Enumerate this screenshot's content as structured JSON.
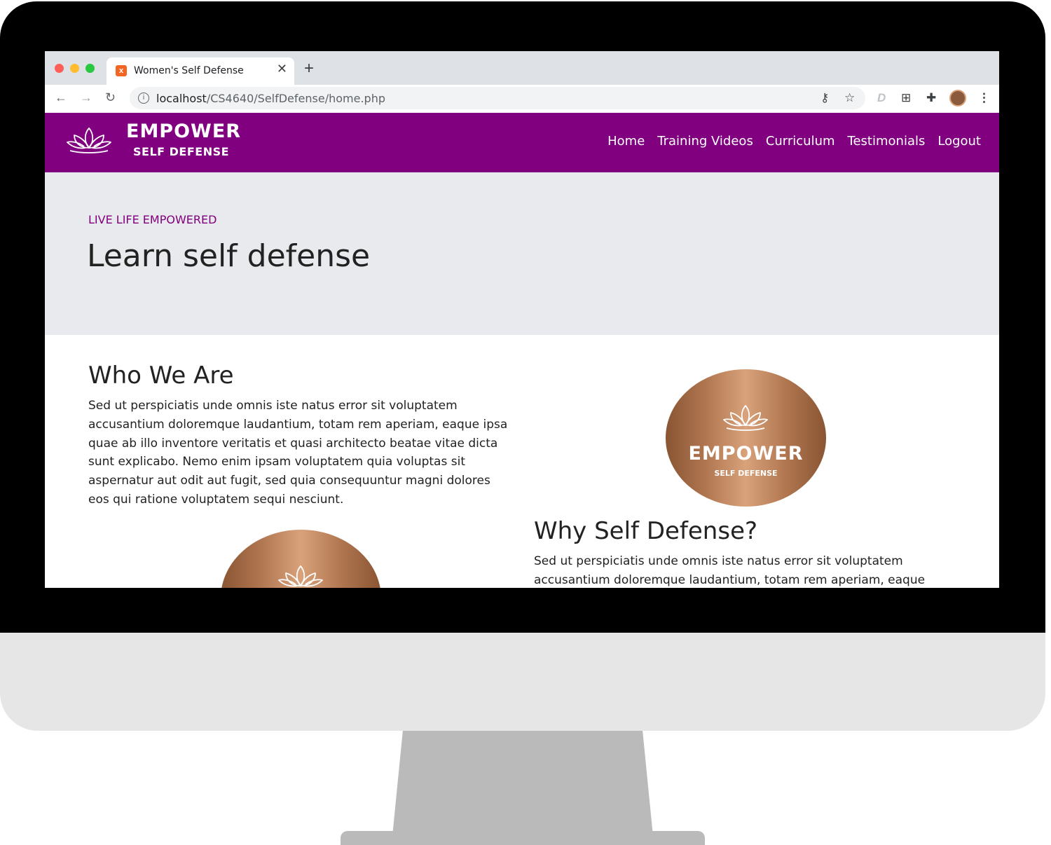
{
  "browser": {
    "tab_title": "Women's Self Defense",
    "url_host": "localhost",
    "url_path": "/CS4640/SelfDefense/home.php"
  },
  "site": {
    "brand_name": "EMPOWER",
    "brand_sub": "SELF DEFENSE",
    "brand_color": "#800080",
    "nav": [
      "Home",
      "Training Videos",
      "Curriculum",
      "Testimonials",
      "Logout"
    ]
  },
  "hero": {
    "eyebrow": "LIVE LIFE EMPOWERED",
    "title": "Learn self defense"
  },
  "sections": {
    "who": {
      "title": "Who We Are",
      "body": "Sed ut perspiciatis unde omnis iste natus error sit voluptatem accusantium doloremque laudantium, totam rem aperiam, eaque ipsa quae ab illo inventore veritatis et quasi architecto beatae vitae dicta sunt explicabo. Nemo enim ipsam voluptatem quia voluptas sit aspernatur aut odit aut fugit, sed quia consequuntur magni dolores eos qui ratione voluptatem sequi nesciunt."
    },
    "why": {
      "title": "Why Self Defense?",
      "body": "Sed ut perspiciatis unde omnis iste natus error sit voluptatem accusantium doloremque laudantium, totam rem aperiam, eaque"
    }
  },
  "badge": {
    "name": "EMPOWER",
    "sub": "SELF DEFENSE"
  }
}
